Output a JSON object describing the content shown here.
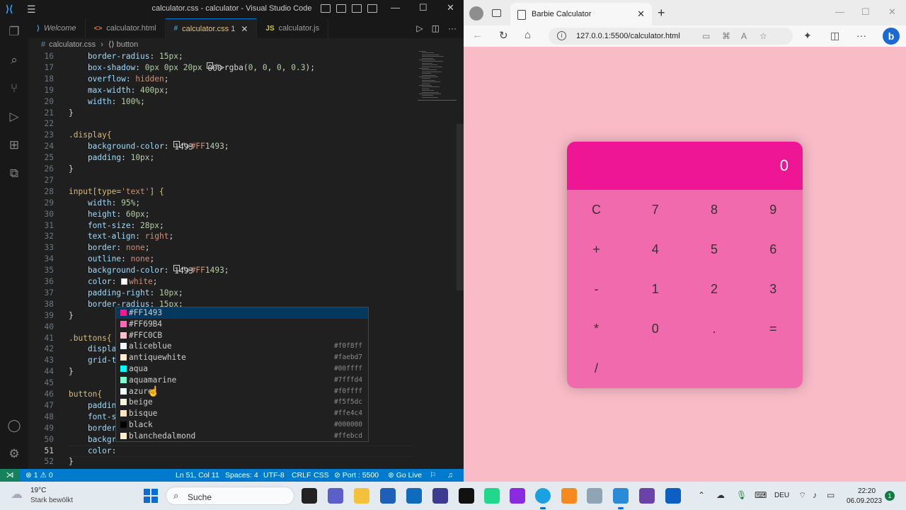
{
  "vscode": {
    "window_title": "calculator.css - calculator - Visual Studio Code",
    "tabs": [
      {
        "label": "Welcome",
        "kind": "vs"
      },
      {
        "label": "calculator.html",
        "kind": "html"
      },
      {
        "label": "calculator.css 1",
        "kind": "css"
      },
      {
        "label": "calculator.js",
        "kind": "js"
      }
    ],
    "breadcrumb": {
      "file": "calculator.css",
      "symbol": "button"
    },
    "code_lines": [
      {
        "n": "16",
        "text": "    border-radius: 15px;"
      },
      {
        "n": "17",
        "text": "    box-shadow: 0px 0px 20px □rgba(0, 0, 0, 0.3);"
      },
      {
        "n": "18",
        "text": "    overflow: hidden;"
      },
      {
        "n": "19",
        "text": "    max-width: 400px;"
      },
      {
        "n": "20",
        "text": "    width: 100%;"
      },
      {
        "n": "21",
        "text": "}"
      },
      {
        "n": "22",
        "text": ""
      },
      {
        "n": "23",
        "text": ".display{"
      },
      {
        "n": "24",
        "text": "    background-color: ■#FF1493;"
      },
      {
        "n": "25",
        "text": "    padding: 10px;"
      },
      {
        "n": "26",
        "text": "}"
      },
      {
        "n": "27",
        "text": ""
      },
      {
        "n": "28",
        "text": "input[type='text'] {"
      },
      {
        "n": "29",
        "text": "    width: 95%;"
      },
      {
        "n": "30",
        "text": "    height: 60px;"
      },
      {
        "n": "31",
        "text": "    font-size: 28px;"
      },
      {
        "n": "32",
        "text": "    text-align: right;"
      },
      {
        "n": "33",
        "text": "    border: none;"
      },
      {
        "n": "34",
        "text": "    outline: none;"
      },
      {
        "n": "35",
        "text": "    background-color: ■#FF1493;"
      },
      {
        "n": "36",
        "text": "    color: □white;"
      },
      {
        "n": "37",
        "text": "    padding-right: 10px;"
      },
      {
        "n": "38",
        "text": "    border-radius: 15px;"
      },
      {
        "n": "39",
        "text": "}"
      },
      {
        "n": "40",
        "text": ""
      },
      {
        "n": "41",
        "text": ".buttons{"
      },
      {
        "n": "42",
        "text": "    displa"
      },
      {
        "n": "43",
        "text": "    grid-t"
      },
      {
        "n": "44",
        "text": "}"
      },
      {
        "n": "45",
        "text": ""
      },
      {
        "n": "46",
        "text": "button{"
      },
      {
        "n": "47",
        "text": "    paddin"
      },
      {
        "n": "48",
        "text": "    font-s"
      },
      {
        "n": "49",
        "text": "    border"
      },
      {
        "n": "50",
        "text": "    backgr"
      },
      {
        "n": "51",
        "text": "    color: "
      },
      {
        "n": "52",
        "text": "}"
      }
    ],
    "suggestions": [
      {
        "label": "#FF1493",
        "hex": "",
        "color": "#FF1493"
      },
      {
        "label": "#FF69B4",
        "hex": "",
        "color": "#FF69B4"
      },
      {
        "label": "#FFC0CB",
        "hex": "",
        "color": "#FFC0CB"
      },
      {
        "label": "aliceblue",
        "hex": "#f0f8ff",
        "color": "#f0f8ff"
      },
      {
        "label": "antiquewhite",
        "hex": "#faebd7",
        "color": "#faebd7"
      },
      {
        "label": "aqua",
        "hex": "#00ffff",
        "color": "#00ffff"
      },
      {
        "label": "aquamarine",
        "hex": "#7fffd4",
        "color": "#7fffd4"
      },
      {
        "label": "azure",
        "hex": "#f0ffff",
        "color": "#f0ffff"
      },
      {
        "label": "beige",
        "hex": "#f5f5dc",
        "color": "#f5f5dc"
      },
      {
        "label": "bisque",
        "hex": "#ffe4c4",
        "color": "#ffe4c4"
      },
      {
        "label": "black",
        "hex": "#000000",
        "color": "#000000"
      },
      {
        "label": "blanchedalmond",
        "hex": "#ffebcd",
        "color": "#ffebcd"
      }
    ],
    "status": {
      "problems_errors": "1",
      "problems_warnings": "0",
      "position": "Ln 51, Col 11",
      "spaces": "Spaces: 4",
      "encoding": "UTF-8",
      "eol": "CRLF",
      "language": "CSS",
      "port": "Port : 5500",
      "golive": "Go Live"
    }
  },
  "browser": {
    "tab_title": "Barbie Calculator",
    "url": "127.0.0.1:5500/calculator.html",
    "calculator": {
      "display_value": "0",
      "display_color": "#EF1695",
      "body_color": "#F06AAD",
      "page_bg": "#F9BCC7",
      "rows": [
        [
          "C",
          "7",
          "8",
          "9"
        ],
        [
          "+",
          "4",
          "5",
          "6"
        ],
        [
          "-",
          "1",
          "2",
          "3"
        ],
        [
          "*",
          "0",
          ".",
          "="
        ],
        [
          "/"
        ]
      ]
    }
  },
  "taskbar": {
    "temperature": "19°C",
    "weather": "Stark bewölkt",
    "search_placeholder": "Suche",
    "language": "DEU",
    "time": "22:20",
    "date": "06.09.2023",
    "notification_count": "1"
  }
}
